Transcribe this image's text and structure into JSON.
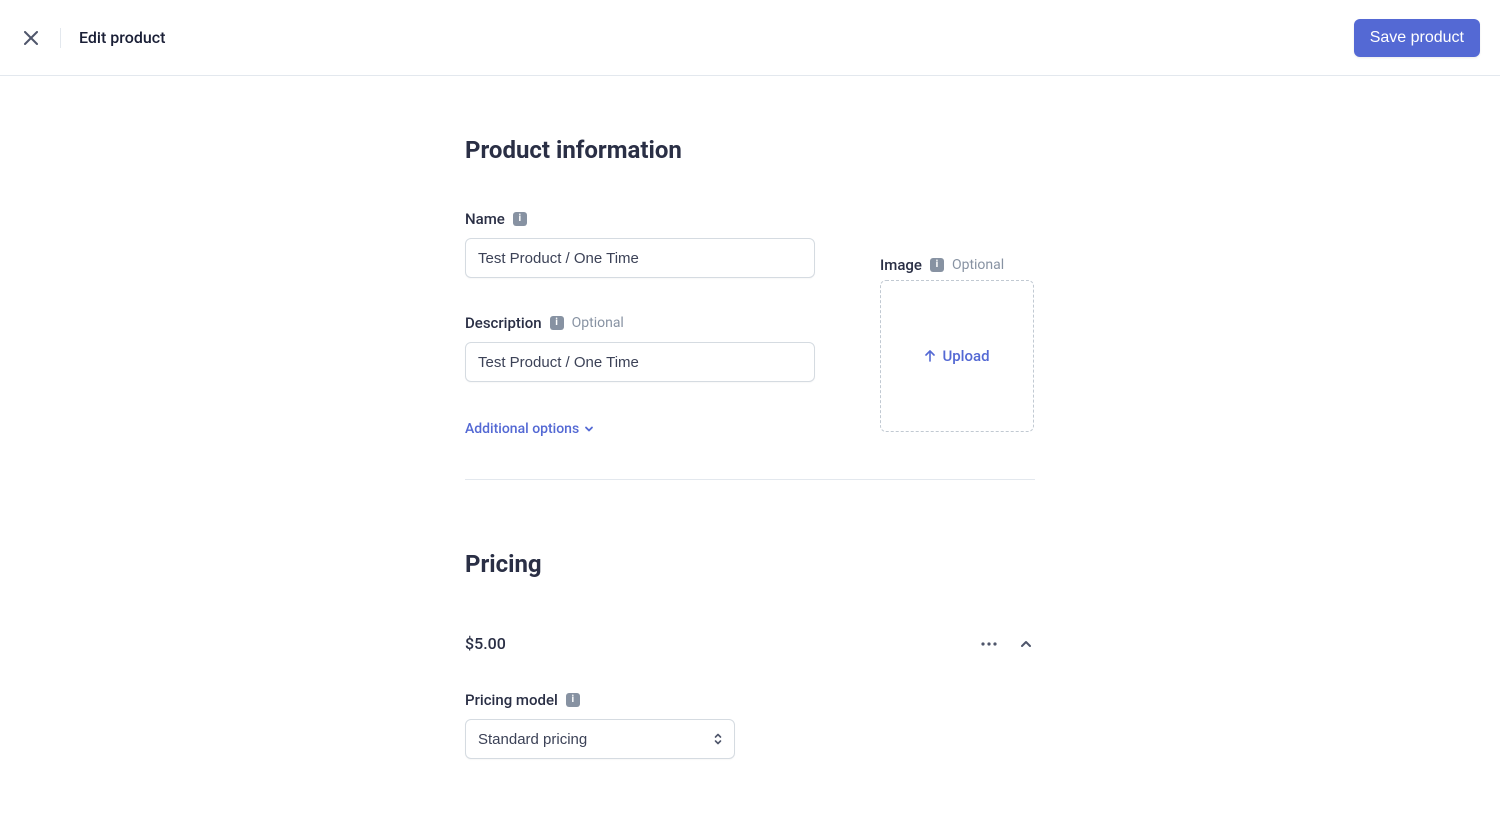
{
  "header": {
    "title": "Edit product",
    "save_label": "Save product"
  },
  "product_info": {
    "section_title": "Product information",
    "name_label": "Name",
    "name_value": "Test Product / One Time",
    "description_label": "Description",
    "description_optional": "Optional",
    "description_value": "Test Product / One Time",
    "image_label": "Image",
    "image_optional": "Optional",
    "upload_label": "Upload",
    "additional_options_label": "Additional options"
  },
  "pricing": {
    "section_title": "Pricing",
    "price_display": "$5.00",
    "model_label": "Pricing model",
    "model_value": "Standard pricing"
  }
}
